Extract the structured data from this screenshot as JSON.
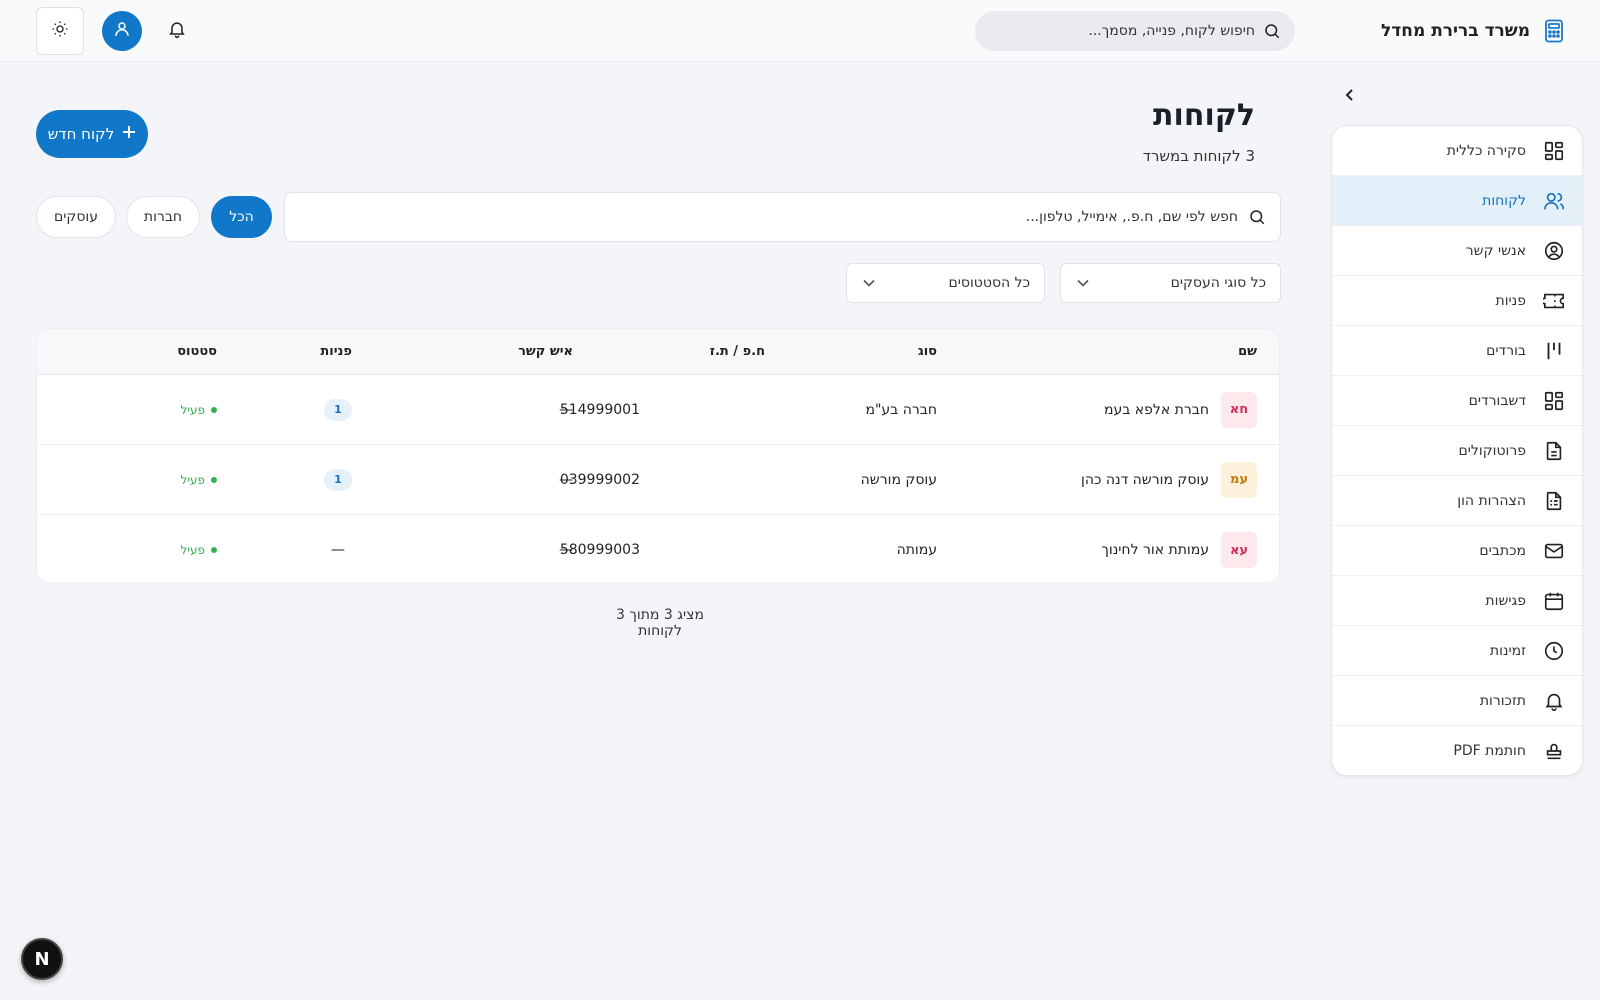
{
  "header": {
    "app_title": "משרד ברירת מחדל",
    "search_placeholder": "חיפוש לקוח, פנייה, מסמך..."
  },
  "sidebar": {
    "items": [
      {
        "label": "סקירה כללית",
        "icon": "dashboard-grid-icon",
        "active": false
      },
      {
        "label": "לקוחות",
        "icon": "users-icon",
        "active": true
      },
      {
        "label": "אנשי קשר",
        "icon": "user-circle-icon",
        "active": false
      },
      {
        "label": "פניות",
        "icon": "ticket-icon",
        "active": false
      },
      {
        "label": "בורדים",
        "icon": "kanban-icon",
        "active": false
      },
      {
        "label": "דשבורדים",
        "icon": "dashboards-icon",
        "active": false
      },
      {
        "label": "פרוטוקולים",
        "icon": "document-icon",
        "active": false
      },
      {
        "label": "הצהרות הון",
        "icon": "declaration-icon",
        "active": false
      },
      {
        "label": "מכתבים",
        "icon": "mail-icon",
        "active": false
      },
      {
        "label": "פגישות",
        "icon": "calendar-icon",
        "active": false
      },
      {
        "label": "זמינות",
        "icon": "clock-icon",
        "active": false
      },
      {
        "label": "תזכורות",
        "icon": "bell-icon",
        "active": false
      },
      {
        "label": "חותמת PDF",
        "icon": "stamp-icon",
        "active": false
      }
    ]
  },
  "main": {
    "title": "לקוחות",
    "subtitle": "3 לקוחות במשרד",
    "new_button": "לקוח חדש",
    "search_placeholder": "חפש לפי שם, ח.פ., אימייל, טלפון...",
    "filters": {
      "all": "הכל",
      "companies": "חברות",
      "businesses": "עוסקים",
      "active": "all"
    },
    "dropdowns": {
      "business_type": "כל סוגי העסקים",
      "status": "כל הסטטוסים"
    },
    "table": {
      "headers": {
        "name": "שם",
        "type": "סוג",
        "id": "ח.פ / ת.ז",
        "contact": "איש קשר",
        "inquiries": "פניות",
        "status": "סטטוס"
      },
      "rows": [
        {
          "initials": "חא",
          "name": "חברת אלפא בעמ",
          "type": "חברה בע\"מ",
          "id": "514999001",
          "contact": "—",
          "inquiries": "1",
          "status": "פעיל",
          "av_bg": "#fde8ec",
          "av_fg": "#d0325a"
        },
        {
          "initials": "עמ",
          "name": "עוסק מורשה דנה כהן",
          "type": "עוסק מורשה",
          "id": "039999002",
          "contact": "—",
          "inquiries": "1",
          "status": "פעיל",
          "av_bg": "#fdf1dc",
          "av_fg": "#c07a10"
        },
        {
          "initials": "עא",
          "name": "עמותת אור לחינוך",
          "type": "עמותה",
          "id": "580999003",
          "contact": "—",
          "inquiries": "—",
          "status": "פעיל",
          "av_bg": "#fde8ec",
          "av_fg": "#d0325a"
        }
      ]
    },
    "footer": "מציג 3 מתוך 3 לקוחות"
  },
  "colors": {
    "primary": "#1177c8",
    "active_bg": "#e3f0fa",
    "status_active": "#33b24f"
  }
}
